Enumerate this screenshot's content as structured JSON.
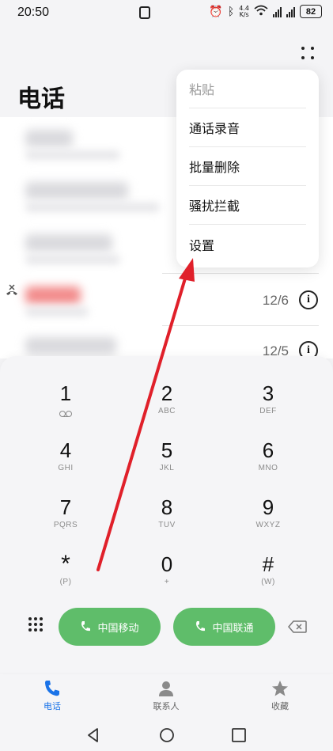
{
  "status_bar": {
    "time": "20:50",
    "net_speed_top": "4.4",
    "net_speed_unit": "K/s",
    "battery": "82"
  },
  "header": {
    "title": "电话"
  },
  "menu": {
    "items": [
      {
        "label": "粘贴",
        "enabled": false
      },
      {
        "label": "通话录音",
        "enabled": true
      },
      {
        "label": "批量删除",
        "enabled": true
      },
      {
        "label": "骚扰拦截",
        "enabled": true
      },
      {
        "label": "设置",
        "enabled": true
      }
    ]
  },
  "call_log": {
    "rows": [
      {
        "date": ""
      },
      {
        "date": ""
      },
      {
        "date": ""
      },
      {
        "date": "12/6",
        "missed": true
      },
      {
        "date": "12/5"
      }
    ]
  },
  "dialpad": {
    "keys": [
      {
        "digit": "1",
        "letters": ""
      },
      {
        "digit": "2",
        "letters": "ABC"
      },
      {
        "digit": "3",
        "letters": "DEF"
      },
      {
        "digit": "4",
        "letters": "GHI"
      },
      {
        "digit": "5",
        "letters": "JKL"
      },
      {
        "digit": "6",
        "letters": "MNO"
      },
      {
        "digit": "7",
        "letters": "PQRS"
      },
      {
        "digit": "8",
        "letters": "TUV"
      },
      {
        "digit": "9",
        "letters": "WXYZ"
      },
      {
        "digit": "*",
        "letters": "(P)"
      },
      {
        "digit": "0",
        "letters": "+"
      },
      {
        "digit": "#",
        "letters": "(W)"
      }
    ],
    "sim1_label": "中国移动",
    "sim2_label": "中国联通"
  },
  "bottom_nav": {
    "tabs": [
      {
        "label": "电话",
        "active": true
      },
      {
        "label": "联系人",
        "active": false
      },
      {
        "label": "收藏",
        "active": false
      }
    ]
  },
  "colors": {
    "call_green": "#5fbd6a",
    "active_blue": "#1a73e8",
    "annotation_red": "#e0202a"
  }
}
